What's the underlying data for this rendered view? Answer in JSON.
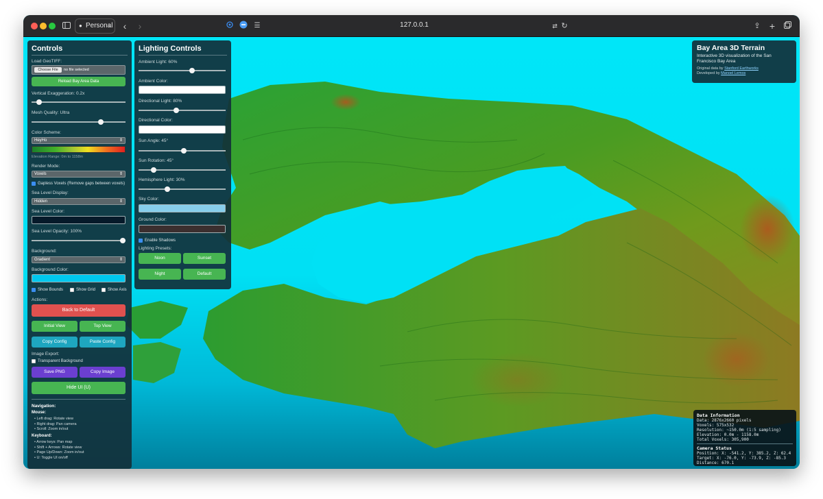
{
  "browser": {
    "profile": "Personal",
    "url": "127.0.0.1"
  },
  "controls": {
    "title": "Controls",
    "load_label": "Load GeoTIFF:",
    "choose_file": "Choose File",
    "no_file": "no file selected",
    "reload_button": "Reload Bay Area Data",
    "vert_exag_label": "Vertical Exaggeration: 0.2x",
    "vert_exag_value": 0.2,
    "mesh_quality_label": "Mesh Quality: Ultra",
    "color_scheme_label": "Color Scheme:",
    "color_scheme_value": "HeyHo",
    "elevation_range": "Elevation Range: 0m to 1158m",
    "render_mode_label": "Render Mode:",
    "render_mode_value": "Voxels",
    "gapless_label": "Gapless Voxels (Remove gaps between voxels)",
    "sea_display_label": "Sea Level Display:",
    "sea_display_value": "Hidden",
    "sea_color_label": "Sea Level Color:",
    "sea_opacity_label": "Sea Level Opacity: 100%",
    "background_label": "Background:",
    "background_value": "Gradient",
    "bg_color_label": "Background Color:",
    "show_bounds": "Show Bounds",
    "show_grid": "Show Grid",
    "show_axis": "Show Axis",
    "actions_label": "Actions:",
    "back_default": "Back to Default",
    "initial_view": "Initial View",
    "top_view": "Top View",
    "copy_config": "Copy Config",
    "paste_config": "Paste Config",
    "image_export_label": "Image Export:",
    "transparent_bg": "Transparent Background",
    "save_png": "Save PNG",
    "copy_image": "Copy Image",
    "hide_ui": "Hide UI (U)",
    "navigation_label": "Navigation:",
    "mouse_label": "Mouse:",
    "mouse_items": [
      "• Left drag: Rotate view",
      "• Right drag: Pan camera",
      "• Scroll: Zoom in/out"
    ],
    "keyboard_label": "Keyboard:",
    "keyboard_items": [
      "• Arrow keys: Pan map",
      "• Shift + Arrows: Rotate view",
      "• Page Up/Down: Zoom in/out",
      "• U: Toggle UI on/off"
    ]
  },
  "lighting": {
    "title": "Lighting Controls",
    "ambient_light": "Ambient Light: 60%",
    "ambient_color": "Ambient Color:",
    "directional_light": "Directional Light: 80%",
    "directional_color": "Directional Color:",
    "sun_angle": "Sun Angle: 45°",
    "sun_rotation": "Sun Rotation: 45°",
    "hemisphere_light": "Hemisphere Light: 30%",
    "sky_color": "Sky Color:",
    "ground_color": "Ground Color:",
    "enable_shadows": "Enable Shadows",
    "presets_label": "Lighting Presets:",
    "noon": "Noon",
    "sunset": "Sunset",
    "night": "Night",
    "default": "Default"
  },
  "info": {
    "title": "Bay Area 3D Terrain",
    "subtitle": "Interactive 3D visualization of the San Francisco Bay Area",
    "original_prefix": "Original data by",
    "original_link": "Stanford Earthworks",
    "developed_prefix": "Developed by",
    "developed_link": "Manoel Lemos"
  },
  "data_info": {
    "title": "Data Information",
    "lines": [
      "Data: 2876x2660 pixels",
      "Voxels: 575x532",
      "Resolution: ~150.0m (1:5 sampling)",
      "Elevation: 0.0m - 1158.0m",
      "Total Voxels: 305,900"
    ],
    "camera_title": "Camera Status",
    "camera_lines": [
      "Position: X: -541.2, Y: 385.2, Z: 62.4",
      "Target: X: -76.0, Y: -73.9, Z: -85.3",
      "Distance: 670.1"
    ]
  },
  "colors": {
    "green_button": "#47b552",
    "red_button": "#e0514f",
    "teal_button": "#1ea6c0",
    "purple_button": "#6b3fd0",
    "sky": "#00e1f5",
    "terrain_low": "#1c9a2a",
    "terrain_high": "#b55a1f"
  }
}
